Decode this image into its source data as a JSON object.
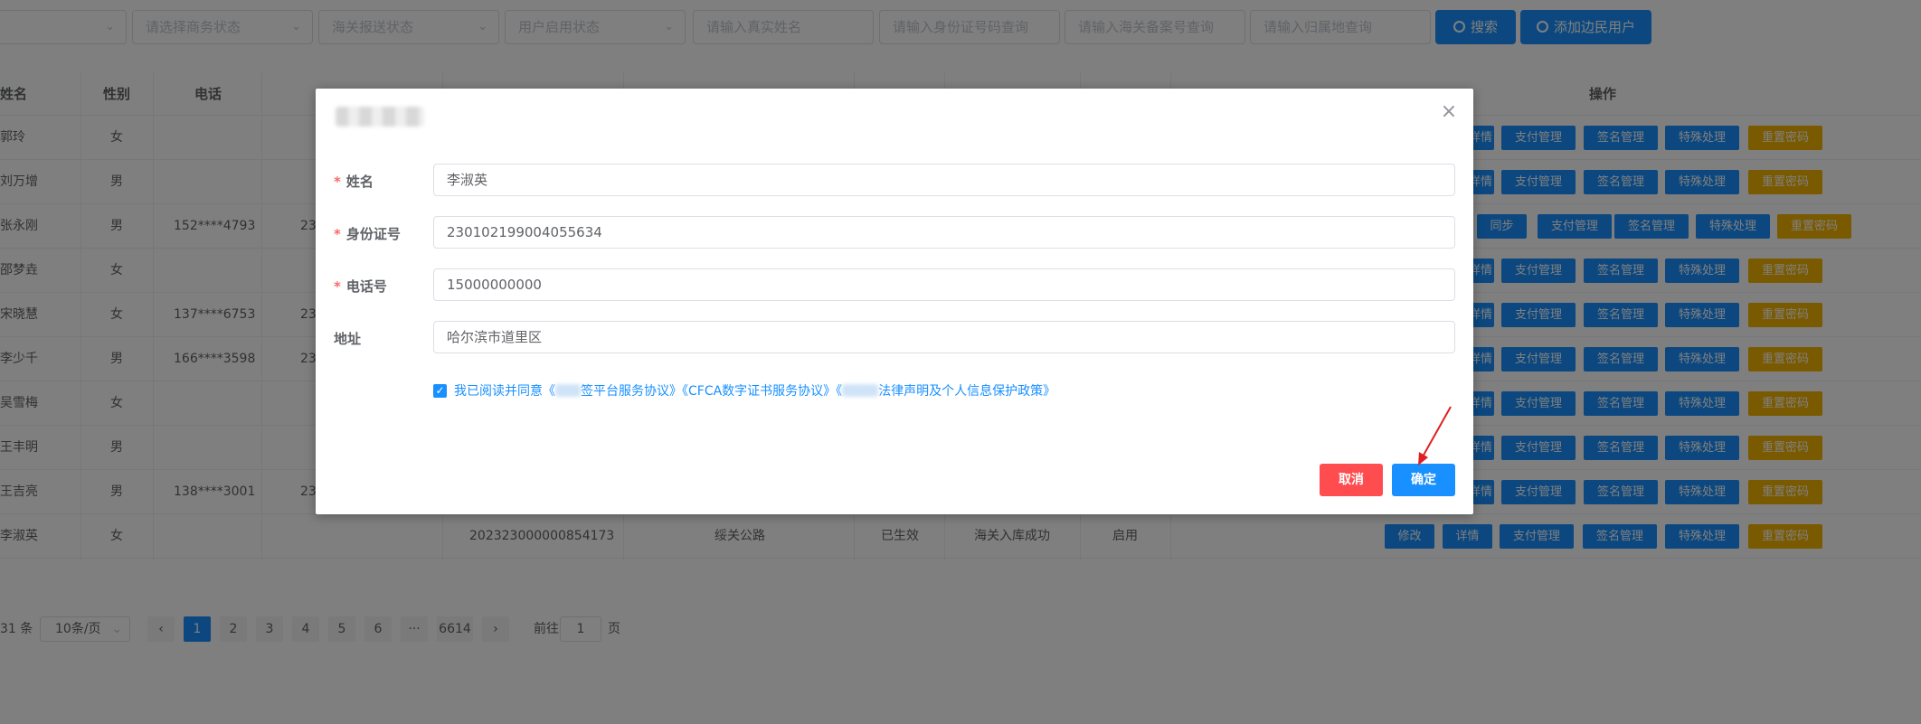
{
  "filters": {
    "selects": [
      "",
      "请选择商务状态",
      "海关报送状态",
      "用户启用状态"
    ],
    "inputs": [
      "请输入真实姓名",
      "请输入身份证号码查询",
      "请输入海关备案号查询",
      "请输入归属地查询"
    ],
    "search_btn": "搜索",
    "add_btn": "添加边民用户"
  },
  "table": {
    "headers": {
      "name": "姓名",
      "gender": "性别",
      "phone": "电话",
      "ops": "操作"
    },
    "rows": [
      {
        "name": "郭玲",
        "gender": "女",
        "phone": "",
        "id_frag": ""
      },
      {
        "name": "刘万增",
        "gender": "男",
        "phone": "",
        "id_frag": ""
      },
      {
        "name": "张永刚",
        "gender": "男",
        "phone": "152****4793",
        "id_frag": "23"
      },
      {
        "name": "邵梦垚",
        "gender": "女",
        "phone": "",
        "id_frag": ""
      },
      {
        "name": "宋晓慧",
        "gender": "女",
        "phone": "137****6753",
        "id_frag": "23"
      },
      {
        "name": "李少千",
        "gender": "男",
        "phone": "166****3598",
        "id_frag": "23"
      },
      {
        "name": "吴雪梅",
        "gender": "女",
        "phone": "",
        "id_frag": ""
      },
      {
        "name": "王丰明",
        "gender": "男",
        "phone": "",
        "id_frag": ""
      },
      {
        "name": "王吉亮",
        "gender": "男",
        "phone": "138****3001",
        "id_frag": "23"
      },
      {
        "name": "李淑英",
        "gender": "女",
        "phone": "",
        "id_frag": "",
        "record_no": "202323000000854173",
        "port": "绥关公路",
        "status": "已生效",
        "customs": "海关入库成功",
        "enabled": "启用"
      }
    ],
    "actions": {
      "edit": "修改",
      "detail": "详情",
      "sync": "同步",
      "pay": "支付管理",
      "sign": "签名管理",
      "special": "特殊处理",
      "reset": "重置密码"
    }
  },
  "pagination": {
    "total": "31 条",
    "page_size": "10条/页",
    "pages": [
      "1",
      "2",
      "3",
      "4",
      "5",
      "6"
    ],
    "ellipsis": "···",
    "last": "6614",
    "goto_pre": "前往",
    "goto_val": "1",
    "goto_post": "页"
  },
  "dialog": {
    "name_label": "姓名",
    "name_value": "李淑英",
    "id_label": "身份证号",
    "id_value": "230102199004055634",
    "phone_label": "电话号",
    "phone_value": "15000000000",
    "addr_label": "地址",
    "addr_value": "哈尔滨市道里区",
    "agree_a": "我已阅读并同意《",
    "agree_b": "签平台服务协议》《CFCA数字证书服务协议》《",
    "agree_c": "法律声明及个人信息保护政策》",
    "cancel": "取消",
    "confirm": "确定"
  },
  "colors": {
    "primary": "#1890ff",
    "warning": "#f5b400",
    "danger": "#ff4d4f"
  }
}
